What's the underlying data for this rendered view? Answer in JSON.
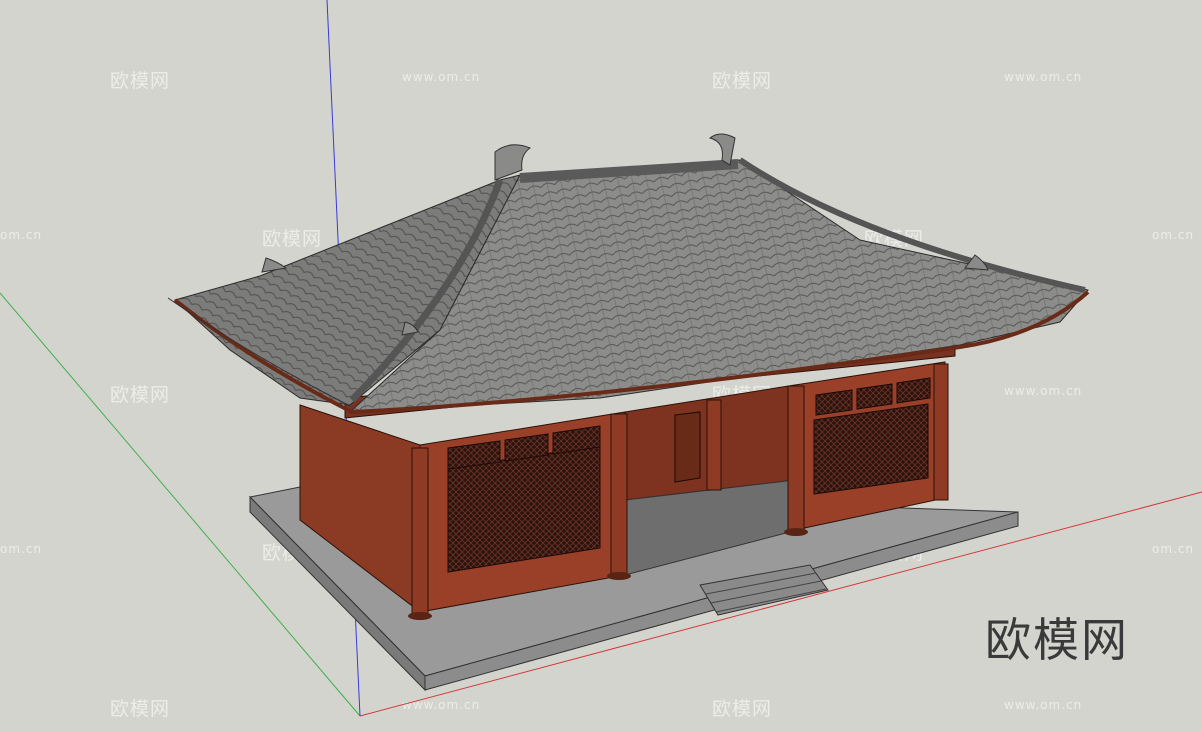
{
  "brand": {
    "label": "欧模网"
  },
  "watermark": {
    "name": "欧模网",
    "site": "www.om.cn",
    "site_short": "om.cn"
  },
  "colors": {
    "background": "#d4d4cf",
    "axis_red": "#d23a3a",
    "axis_green": "#3fb04a",
    "axis_blue": "#3a3ad8",
    "roof": "#8a8a88",
    "wall": "#8b3a24",
    "platform": "#8e8e8e"
  },
  "model": {
    "type": "traditional-chinese-hall-3d-model"
  }
}
